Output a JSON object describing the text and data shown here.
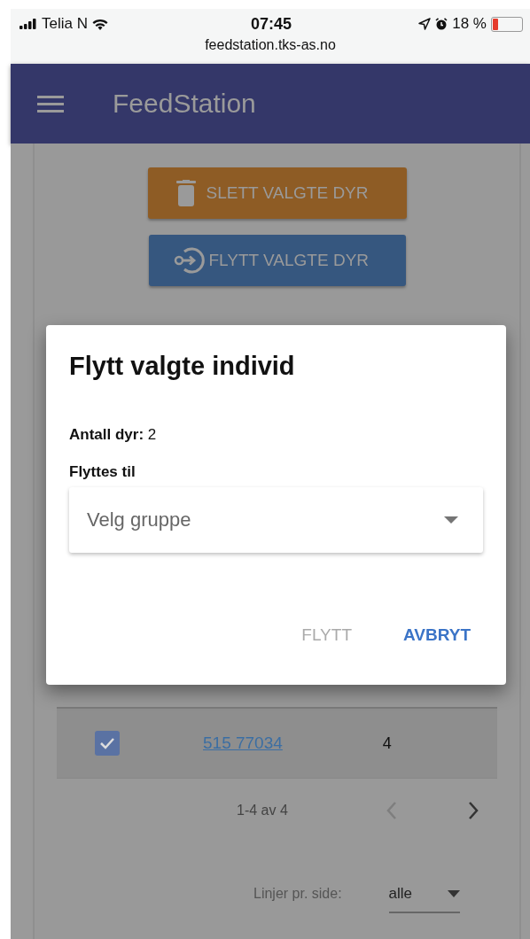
{
  "status_bar": {
    "carrier": "Telia N",
    "time": "07:45",
    "battery": "18 %",
    "url": "feedstation.tks-as.no"
  },
  "app_bar": {
    "title": "FeedStation"
  },
  "actions": [
    {
      "label": "SLETT VALGTE DYR",
      "kind": "delete"
    },
    {
      "label": "FLYTT VALGTE DYR",
      "kind": "move"
    }
  ],
  "table": {
    "rows": [
      {
        "checked": true,
        "id": "515 77034",
        "column_3": "4"
      }
    ]
  },
  "pagination": {
    "range": "1-4 av 4",
    "prev_disabled": true,
    "next_disabled": false,
    "rows_label": "Linjer pr. side:",
    "rows_value": "alle"
  },
  "dialog": {
    "title": "Flytt valgte individ",
    "count": "**Antall dyr:** 2",
    "field_label": "Flyttes til",
    "placeholder": "Velg gruppe",
    "buttons": [
      {
        "label": "FLYTT",
        "disabled": true
      },
      {
        "label": "AVBRYT",
        "disabled": false
      }
    ]
  }
}
